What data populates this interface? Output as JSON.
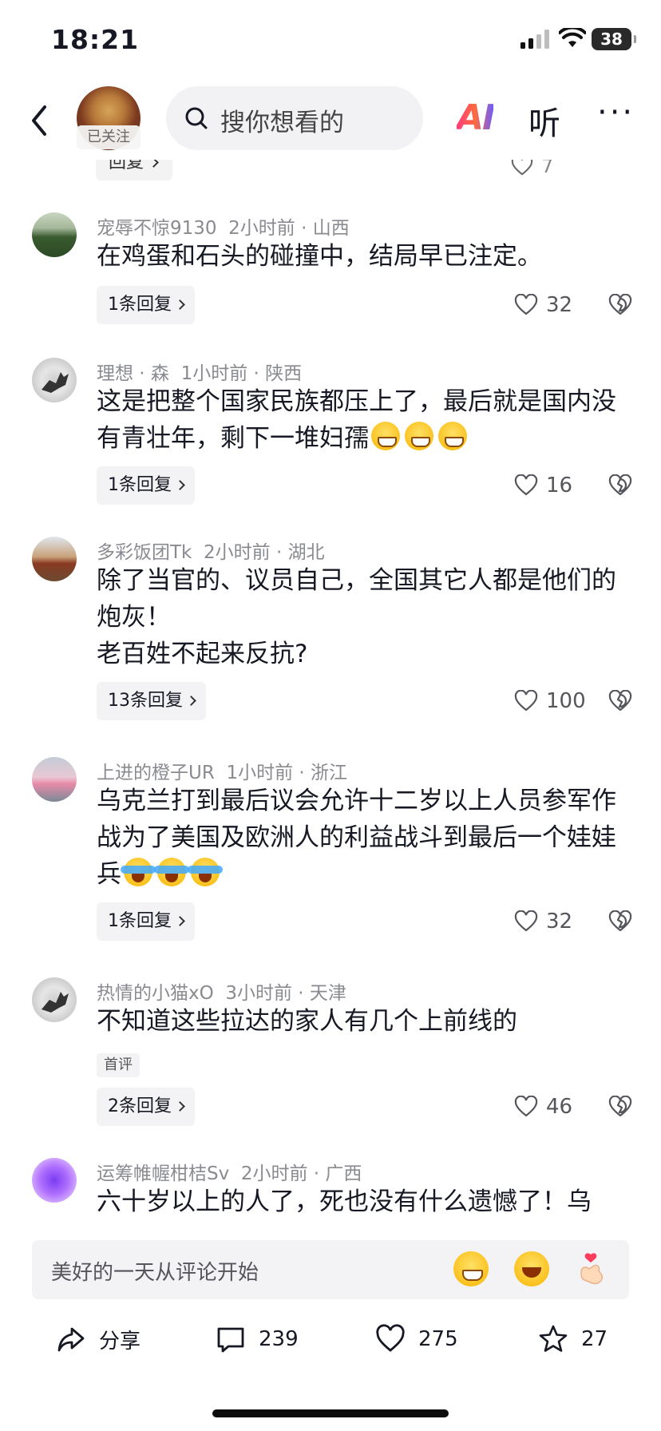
{
  "status_bar": {
    "time": "18:21",
    "battery": "38"
  },
  "header": {
    "follow_tag": "已关注",
    "search_placeholder": "搜你想看的",
    "ai_label": "AI",
    "listen_label": "听",
    "more_label": "···"
  },
  "partial_reply": {
    "label": "回复",
    "likes": "7"
  },
  "comments": [
    {
      "user": "宠辱不惊9130",
      "time": "2小时前",
      "region": "山西",
      "text": "在鸡蛋和石头的碰撞中，结局早已注定。",
      "replies": "1条回复",
      "likes": "32"
    },
    {
      "user": "理想 · 森",
      "time": "1小时前",
      "region": "陕西",
      "text": "这是把整个国家民族都压上了，最后就是国内没有青壮年，剩下一堆妇孺",
      "replies": "1条回复",
      "likes": "16"
    },
    {
      "user": "多彩饭团Tk",
      "time": "2小时前",
      "region": "湖北",
      "text_lines": [
        "除了当官的、议员自己，全国其它人都是他们的炮灰！",
        "老百姓不起来反抗?"
      ],
      "replies": "13条回复",
      "likes": "100"
    },
    {
      "user": "上进的橙子UR",
      "time": "1小时前",
      "region": "浙江",
      "text": "乌克兰打到最后议会允许十二岁以上人员参军作战为了美国及欧洲人的利益战斗到最后一个娃娃兵",
      "replies": "1条回复",
      "likes": "32"
    },
    {
      "user": "热情的小猫xO",
      "time": "3小时前",
      "region": "天津",
      "text": "不知道这些拉达的家人有几个上前线的",
      "tag": "首评",
      "replies": "2条回复",
      "likes": "46"
    },
    {
      "user": "运筹帷幄柑桔Sv",
      "time": "2小时前",
      "region": "广西",
      "text": "六十岁以上的人了，死也没有什么遗憾了！乌"
    }
  ],
  "composer": {
    "placeholder": "美好的一天从评论开始"
  },
  "bottom_bar": {
    "share": "分享",
    "comments": "239",
    "likes": "275",
    "favorites": "27"
  },
  "colors": {
    "text": "#161823",
    "meta": "#8a8b91",
    "chip_bg": "#f3f3f5"
  }
}
